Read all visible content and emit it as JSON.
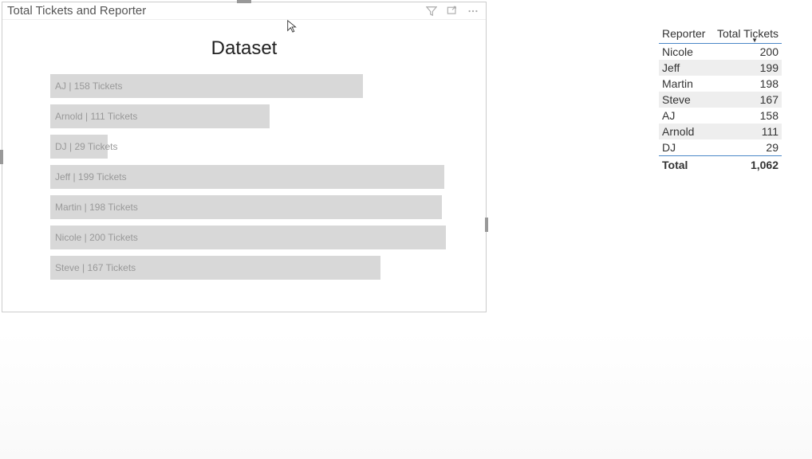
{
  "visual": {
    "title": "Total Tickets and Reporter",
    "chart_title": "Dataset"
  },
  "chart_data": {
    "type": "bar",
    "title": "Dataset",
    "orientation": "horizontal",
    "categories": [
      "AJ",
      "Arnold",
      "DJ",
      "Jeff",
      "Martin",
      "Nicole",
      "Steve"
    ],
    "values": [
      158,
      111,
      29,
      199,
      198,
      200,
      167
    ],
    "label_suffix": "Tickets",
    "label_sep": " | ",
    "max": 200
  },
  "table": {
    "headers": {
      "reporter": "Reporter",
      "total": "Total Tickets"
    },
    "rows": [
      {
        "name": "Nicole",
        "value": "200"
      },
      {
        "name": "Jeff",
        "value": "199"
      },
      {
        "name": "Martin",
        "value": "198"
      },
      {
        "name": "Steve",
        "value": "167"
      },
      {
        "name": "AJ",
        "value": "158"
      },
      {
        "name": "Arnold",
        "value": "111"
      },
      {
        "name": "DJ",
        "value": "29"
      }
    ],
    "total_label": "Total",
    "total_value": "1,062"
  }
}
